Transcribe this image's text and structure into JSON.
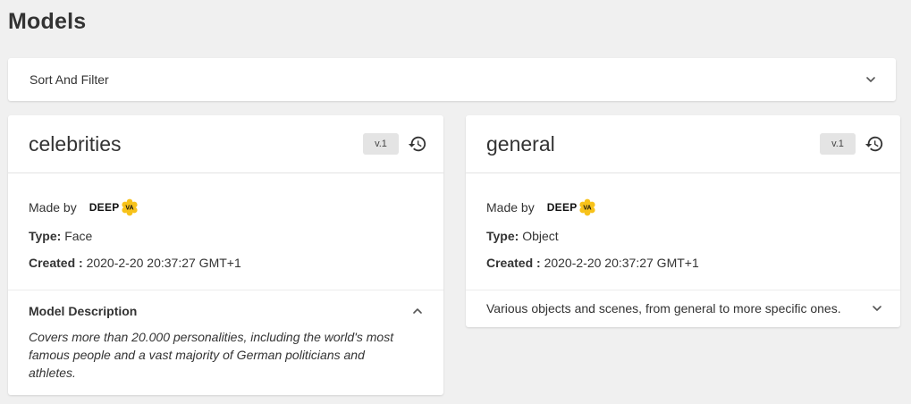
{
  "page": {
    "title": "Models"
  },
  "filter": {
    "label": "Sort And Filter",
    "icon": "chevron-down-icon"
  },
  "models": [
    {
      "name": "celebrities",
      "version": "v.1",
      "made_by_label": "Made by",
      "brand": {
        "text": "DEEP",
        "badge": "VA",
        "accent": "#f7c21a"
      },
      "type_label": "Type:",
      "type_value": "Face",
      "created_label": "Created :",
      "created_value": "2020-2-20 20:37:27 GMT+1",
      "description_title": "Model Description",
      "description": "Covers more than 20.000 personalities, including the world's most famous people and a vast majority of German politicians and athletes.",
      "expanded": true
    },
    {
      "name": "general",
      "version": "v.1",
      "made_by_label": "Made by",
      "brand": {
        "text": "DEEP",
        "badge": "VA",
        "accent": "#f7c21a"
      },
      "type_label": "Type:",
      "type_value": "Object",
      "created_label": "Created :",
      "created_value": "2020-2-20 20:37:27 GMT+1",
      "short_description": "Various objects and scenes, from general to more specific ones.",
      "expanded": false
    }
  ]
}
